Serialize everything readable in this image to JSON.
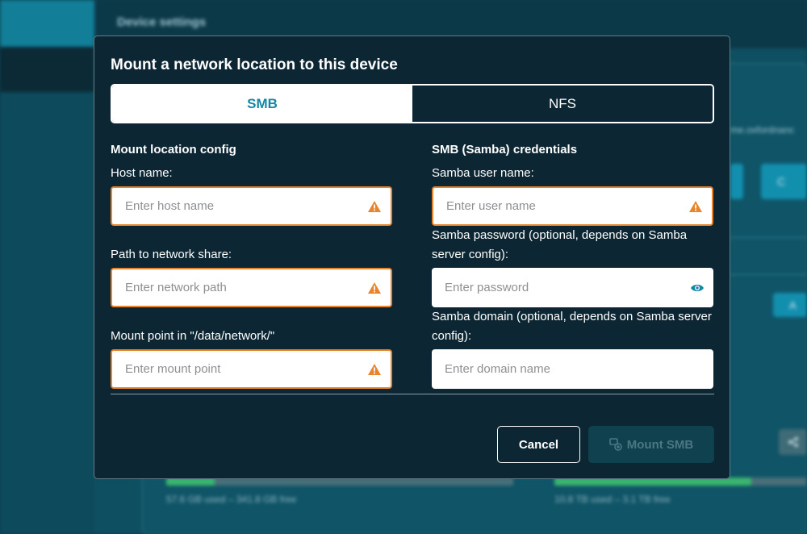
{
  "background": {
    "header_title": "Device settings",
    "host_fragment": "me.oxfordnanc",
    "button_fragment_1": "C",
    "button_fragment_2": "A",
    "usage_left": "57.6 GB used – 341.8 GB free",
    "usage_right": "10.8 TB used – 3.1 TB free"
  },
  "modal": {
    "title": "Mount a network location to this device",
    "tabs": [
      {
        "label": "SMB",
        "active": true
      },
      {
        "label": "NFS",
        "active": false
      }
    ],
    "left": {
      "section_title": "Mount location config",
      "host": {
        "label": "Host name:",
        "placeholder": "Enter host name"
      },
      "path": {
        "label": "Path to network share:",
        "placeholder": "Enter network path"
      },
      "mount": {
        "label": "Mount point in \"/data/network/\"",
        "placeholder": "Enter mount point"
      }
    },
    "right": {
      "section_title": "SMB (Samba) credentials",
      "user": {
        "label": "Samba user name:",
        "placeholder": "Enter user name"
      },
      "password": {
        "label": "Samba password (optional, depends on Samba server config):",
        "placeholder": "Enter password"
      },
      "domain": {
        "label": "Samba domain (optional, depends on Samba server config):",
        "placeholder": "Enter domain name"
      }
    },
    "buttons": {
      "cancel": "Cancel",
      "mount": "Mount SMB"
    }
  },
  "icons": {
    "warning": "warning-triangle-icon",
    "eye": "eye-icon",
    "mount": "mount-network-icon",
    "share": "share-icon"
  },
  "colors": {
    "accent": "#1388a6",
    "warning": "#e8842c",
    "modal_bg": "#0c2733"
  },
  "usage_fraction": {
    "left": 0.14,
    "right": 0.78
  }
}
